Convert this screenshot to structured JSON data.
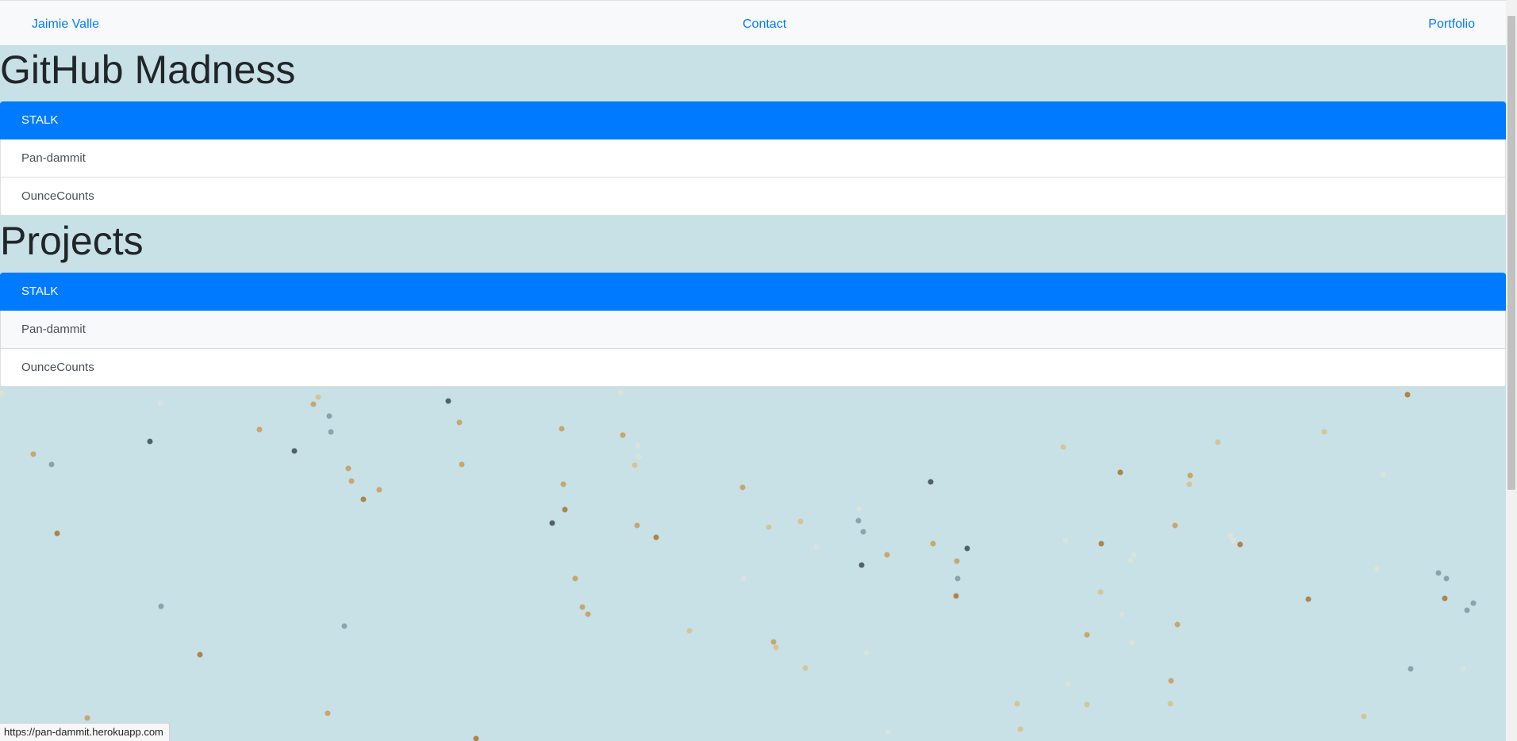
{
  "nav": {
    "brand": "Jaimie Valle",
    "contact": "Contact",
    "portfolio": "Portfolio"
  },
  "github_section": {
    "title": "GitHub Madness",
    "items": [
      {
        "label": "STALK",
        "active": true
      },
      {
        "label": "Pan-dammit",
        "active": false
      },
      {
        "label": "OunceCounts",
        "active": false
      }
    ]
  },
  "projects_section": {
    "title": "Projects",
    "items": [
      {
        "label": "STALK",
        "active": true
      },
      {
        "label": "Pan-dammit",
        "active": false,
        "hovered": true
      },
      {
        "label": "OunceCounts",
        "active": false
      }
    ]
  },
  "status_bar": {
    "url": "https://pan-dammit.herokuapp.com"
  },
  "colors": {
    "background": "#c7e1e6",
    "navbar": "#f8f9fa",
    "link": "#007bff",
    "active_item": "#007bff",
    "particle_palette": [
      "#a9732f",
      "#c89b58",
      "#d6c08a",
      "#3d4a52",
      "#7d9aa3",
      "#e7e6c8"
    ]
  }
}
